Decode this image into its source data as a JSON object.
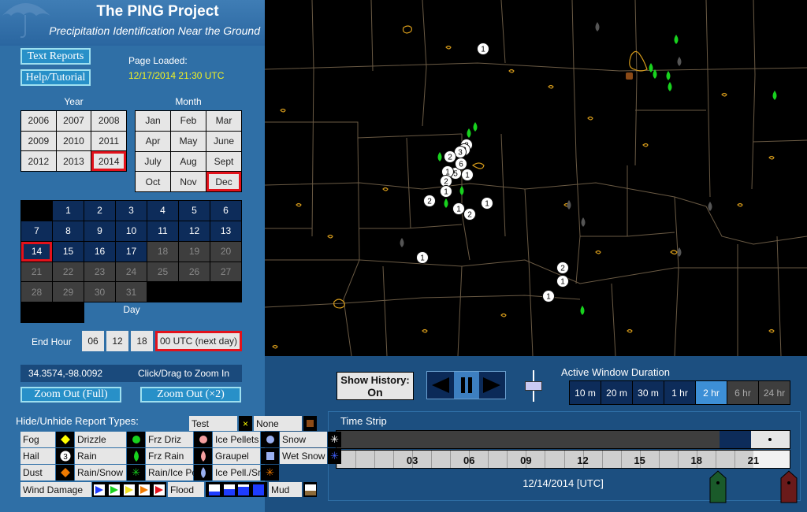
{
  "header": {
    "title": "The PING Project",
    "subtitle": "Precipitation Identification Near the Ground"
  },
  "links": {
    "text_reports": "Text Reports",
    "help": "Help/Tutorial"
  },
  "page_loaded": {
    "label": "Page Loaded:",
    "value": "12/17/2014 21:30 UTC"
  },
  "year": {
    "heading": "Year",
    "items": [
      "2006",
      "2007",
      "2008",
      "2009",
      "2010",
      "2011",
      "2012",
      "2013",
      "2014"
    ],
    "selected": "2014"
  },
  "month": {
    "heading": "Month",
    "items": [
      "Jan",
      "Feb",
      "Mar",
      "Apr",
      "May",
      "June",
      "July",
      "Aug",
      "Sept",
      "Oct",
      "Nov",
      "Dec"
    ],
    "selected": "Dec"
  },
  "day": {
    "heading": "Day",
    "selected": "14",
    "rows": [
      [
        "",
        "1",
        "2",
        "3",
        "4",
        "5",
        "6"
      ],
      [
        "7",
        "8",
        "9",
        "10",
        "11",
        "12",
        "13"
      ],
      [
        "14",
        "15",
        "16",
        "17",
        "18",
        "19",
        "20"
      ],
      [
        "21",
        "22",
        "23",
        "24",
        "25",
        "26",
        "27"
      ],
      [
        "28",
        "29",
        "30",
        "31",
        "",
        "",
        ""
      ],
      [
        "",
        "",
        "",
        "",
        "",
        "",
        ""
      ]
    ]
  },
  "end_hour": {
    "label": "End Hour",
    "options": [
      "06",
      "12",
      "18",
      "00 UTC (next day)"
    ],
    "selected": "00 UTC (next day)"
  },
  "coords": {
    "value": "34.3574,-98.0092",
    "hint": "Click/Drag to Zoom In"
  },
  "zoom": {
    "full": "Zoom Out  (Full)",
    "x2": "Zoom Out   (×2)"
  },
  "legend": {
    "heading": "Hide/Unhide Report Types:",
    "test": "Test",
    "none": "None",
    "fog": "Fog",
    "drizzle": "Drizzle",
    "frz_driz": "Frz Driz",
    "ice_pellets": "Ice Pellets",
    "snow": "Snow",
    "hail": "Hail",
    "rain": "Rain",
    "frz_rain": "Frz Rain",
    "graupel": "Graupel",
    "wet_snow": "Wet Snow",
    "dust": "Dust",
    "rain_snow": "Rain/Snow",
    "rain_ice": "Rain/Ice Pell.",
    "ice_snow": "Ice Pell./Snow",
    "wind": "Wind Damage",
    "flood": "Flood",
    "mud": "Mud",
    "rain_count_label": "3"
  },
  "history": {
    "label": "Show History:",
    "value": "On"
  },
  "window": {
    "heading": "Active Window Duration",
    "options": [
      "10 m",
      "20 m",
      "30 m",
      "1 hr",
      "2 hr",
      "6 hr",
      "24 hr"
    ],
    "selected": "2 hr"
  },
  "timestrip": {
    "heading": "Time Strip",
    "ticks": [
      "03",
      "06",
      "09",
      "12",
      "15",
      "18",
      "21"
    ],
    "date": "12/14/2014 [UTC]"
  },
  "map_markers": [
    {
      "label": "1"
    },
    {
      "label": "3"
    },
    {
      "label": "3"
    },
    {
      "label": "3"
    },
    {
      "label": "5"
    },
    {
      "label": "6"
    },
    {
      "label": "1"
    },
    {
      "label": "2"
    },
    {
      "label": "1"
    },
    {
      "label": "2"
    },
    {
      "label": "1"
    },
    {
      "label": "2"
    },
    {
      "label": "1"
    },
    {
      "label": "2"
    },
    {
      "label": "1"
    },
    {
      "label": "1"
    },
    {
      "label": "2"
    },
    {
      "label": "1"
    },
    {
      "label": "1"
    }
  ],
  "colors": {
    "past_day": "#0d2c5a",
    "future_day": "#3e3e3e",
    "selected_border": "#e3121b",
    "rain_green": "#18d21e",
    "county_line": "#6a5a44",
    "lake_outline": "#d59a1a"
  }
}
